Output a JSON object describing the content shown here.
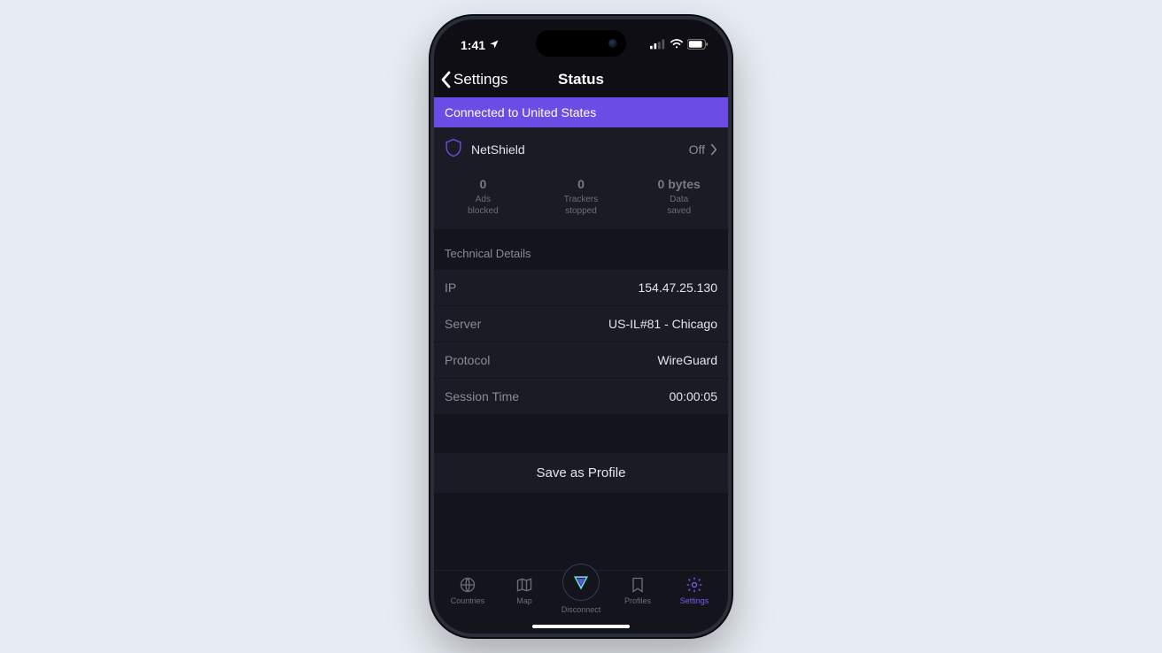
{
  "statusbar": {
    "time": "1:41"
  },
  "navbar": {
    "back_label": "Settings",
    "title": "Status"
  },
  "banner": {
    "text": "Connected to United States"
  },
  "netshield": {
    "title": "NetShield",
    "value": "Off",
    "stats": [
      {
        "num": "0",
        "l1": "Ads",
        "l2": "blocked"
      },
      {
        "num": "0",
        "l1": "Trackers",
        "l2": "stopped"
      },
      {
        "num": "0 bytes",
        "l1": "Data",
        "l2": "saved"
      }
    ]
  },
  "tech": {
    "section_label": "Technical Details",
    "rows": [
      {
        "k": "IP",
        "v": "154.47.25.130"
      },
      {
        "k": "Server",
        "v": "US-IL#81 - Chicago"
      },
      {
        "k": "Protocol",
        "v": "WireGuard"
      },
      {
        "k": "Session Time",
        "v": "00:00:05"
      }
    ]
  },
  "save": {
    "label": "Save as Profile"
  },
  "tabs": {
    "items": [
      {
        "label": "Countries"
      },
      {
        "label": "Map"
      },
      {
        "label": "Disconnect"
      },
      {
        "label": "Profiles"
      },
      {
        "label": "Settings"
      }
    ]
  },
  "colors": {
    "accent": "#6b4de6",
    "active_tab": "#7a5cf0"
  }
}
